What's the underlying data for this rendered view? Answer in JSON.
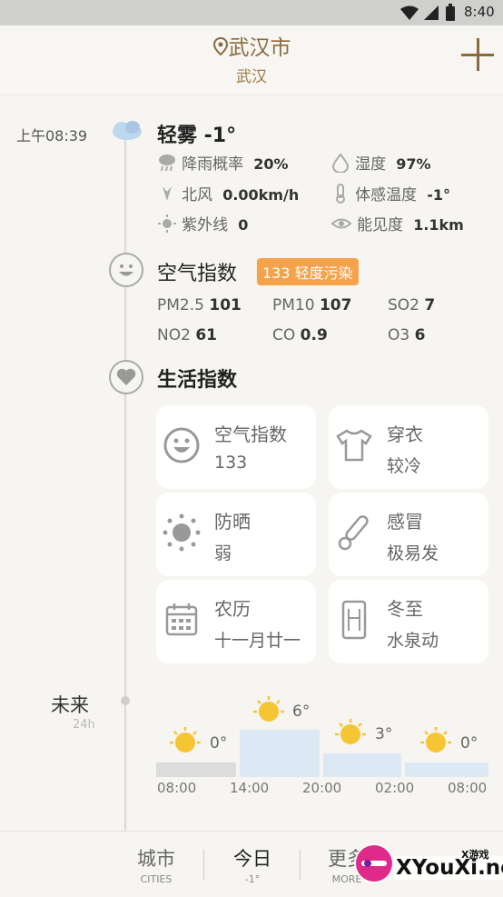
{
  "status": {
    "time": "8:40"
  },
  "header": {
    "city": "武汉市",
    "subtitle": "武汉"
  },
  "current": {
    "time": "上午08:39",
    "condition": "轻雾 -1°",
    "rain_label": "降雨概率",
    "rain": "20%",
    "humidity_label": "湿度",
    "humidity": "97%",
    "wind_label": "北风",
    "wind": "0.00km/h",
    "feel_label": "体感温度",
    "feel": "-1°",
    "uv_label": "紫外线",
    "uv": "0",
    "visibility_label": "能见度",
    "visibility": "1.1km"
  },
  "air": {
    "title": "空气指数",
    "badge": "133 轻度污染",
    "items": [
      {
        "name": "PM2.5",
        "value": "101"
      },
      {
        "name": "PM10",
        "value": "107"
      },
      {
        "name": "SO2",
        "value": "7"
      },
      {
        "name": "NO2",
        "value": "61"
      },
      {
        "name": "CO",
        "value": "0.9"
      },
      {
        "name": "O3",
        "value": "6"
      }
    ]
  },
  "life": {
    "title": "生活指数",
    "cards": [
      {
        "title": "空气指数",
        "value": "133",
        "icon": "smile-icon"
      },
      {
        "title": "穿衣",
        "value": "较冷",
        "icon": "shirt-icon"
      },
      {
        "title": "防晒",
        "value": "弱",
        "icon": "sun-icon"
      },
      {
        "title": "感冒",
        "value": "极易发",
        "icon": "thermometer-icon"
      },
      {
        "title": "农历",
        "value": "十一月廿一",
        "icon": "calendar-icon"
      },
      {
        "title": "冬至",
        "value": "水泉动",
        "icon": "solar-term-icon"
      }
    ]
  },
  "forecast": {
    "label": "未来",
    "sub": "24h",
    "temps": [
      "0°",
      "6°",
      "3°",
      "0°"
    ],
    "times": [
      "08:00",
      "14:00",
      "20:00",
      "02:00",
      "08:00"
    ]
  },
  "nav": {
    "cities": "城市",
    "cities_en": "CITIES",
    "today": "今日",
    "today_sub": "-1°",
    "more": "更多",
    "more_en": "MORE"
  },
  "watermark": {
    "brand": "XYouXi.net",
    "small": "X游戏"
  },
  "colors": {
    "accent": "#8b6a3f",
    "badge": "#f6a24b",
    "bar": "#dce9f5",
    "sun": "#f5c533"
  }
}
